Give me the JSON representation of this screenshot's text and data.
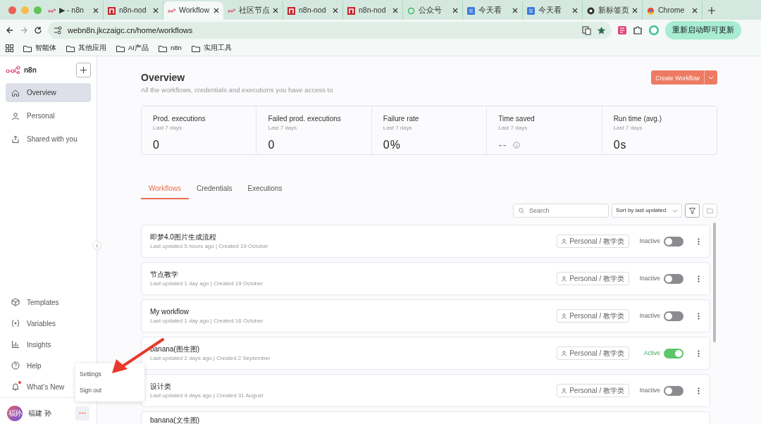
{
  "browser": {
    "tabs": [
      {
        "title": "▶ - n8n",
        "selected": false
      },
      {
        "title": "n8n-nod",
        "selected": false
      },
      {
        "title": "Workflow",
        "selected": true
      },
      {
        "title": "社区节点",
        "selected": false
      },
      {
        "title": "n8n-nod",
        "selected": false
      },
      {
        "title": "n8n-nod",
        "selected": false
      },
      {
        "title": "公众号",
        "selected": false
      },
      {
        "title": "今天看",
        "selected": false
      },
      {
        "title": "今天看",
        "selected": false
      },
      {
        "title": "新标签页",
        "selected": false
      },
      {
        "title": "Chrome",
        "selected": false
      }
    ],
    "address": "webn8n.jkczaigc.cn/home/workflows",
    "update_button": "重新启动即可更新",
    "bookmarks": [
      "智能体",
      "其他应用",
      "AI产品",
      "n8n",
      "实用工具"
    ]
  },
  "sidebar": {
    "logo": "n8n",
    "nav": [
      {
        "label": "Overview",
        "selected": true
      },
      {
        "label": "Personal",
        "selected": false
      },
      {
        "label": "Shared with you",
        "selected": false
      }
    ],
    "bottom_nav": [
      {
        "label": "Templates",
        "notification": false
      },
      {
        "label": "Variables",
        "notification": false
      },
      {
        "label": "Insights",
        "notification": false
      },
      {
        "label": "Help",
        "notification": false
      },
      {
        "label": "What’s New",
        "notification": true
      }
    ],
    "user": {
      "avatar": "福孙",
      "name": "福建 孙"
    },
    "menu": [
      "Settings",
      "Sign out"
    ]
  },
  "main": {
    "title": "Overview",
    "subtitle": "All the workflows, credentials and executions you have access to",
    "create_button": "Create Workflow",
    "stats": [
      {
        "kind": "value",
        "label": "Prod. executions",
        "period": "Last 7 days",
        "value": "0"
      },
      {
        "kind": "value",
        "label": "Failed prod. executions",
        "period": "Last 7 days",
        "value": "0"
      },
      {
        "kind": "value",
        "label": "Failure rate",
        "period": "Last 7 days",
        "value": "0%"
      },
      {
        "kind": "unset",
        "label": "Time saved",
        "period": "Last 7 days",
        "value": "--"
      },
      {
        "kind": "value",
        "label": "Run time (avg.)",
        "period": "Last 7 days",
        "value": "0s"
      }
    ],
    "tabs": [
      {
        "label": "Workflows",
        "selected": true
      },
      {
        "label": "Credentials",
        "selected": false
      },
      {
        "label": "Executions",
        "selected": false
      }
    ],
    "search": {
      "placeholder": "Search"
    },
    "sort": "Sort by last updated",
    "workflows": [
      {
        "name": "即梦4.0图片生成流程",
        "meta": "Last updated 5 hours ago | Created 19 October",
        "owner": "Personal / 教学类",
        "status": "Inactive",
        "on": false
      },
      {
        "name": "节点教学",
        "meta": "Last updated 1 day ago | Created 19 October",
        "owner": "Personal / 教学类",
        "status": "Inactive",
        "on": false
      },
      {
        "name": "My workflow",
        "meta": "Last updated 1 day ago | Created 16 October",
        "owner": "Personal / 教学类",
        "status": "Inactive",
        "on": false
      },
      {
        "name": "banana(图生图)",
        "meta": "Last updated 2 days ago | Created 2 September",
        "owner": "Personal / 教学类",
        "status": "Active",
        "on": true
      },
      {
        "name": "设计类",
        "meta": "Last updated 4 days ago | Created 31 August",
        "owner": "Personal / 教学类",
        "status": "Inactive",
        "on": false
      },
      {
        "name": "banana(文生图)"
      }
    ]
  }
}
